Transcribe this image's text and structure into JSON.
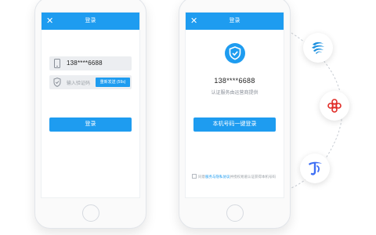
{
  "colors": {
    "accent": "#1e9cf0",
    "mobile": "#1a8fde",
    "unicom": "#e02b26",
    "telecom": "#3e6ff4"
  },
  "phone1": {
    "close_icon": "close-icon",
    "title": "登录",
    "phone_value": "138****6688",
    "code_placeholder": "输入验证码",
    "resend_label": "重新发送 (59s)",
    "login_button": "登录"
  },
  "phone2": {
    "close_icon": "close-icon",
    "title": "登录",
    "masked_number": "138****6688",
    "provider_text": "认证服务由运营商提供",
    "onekey_button": "本机号码一键登录",
    "agree_prefix": "同意",
    "agree_link": "服务与隐私协议",
    "agree_suffix": "并授权易盾认证获得本机号码"
  },
  "carriers": [
    "china-mobile-logo",
    "china-unicom-logo",
    "china-telecom-logo"
  ]
}
